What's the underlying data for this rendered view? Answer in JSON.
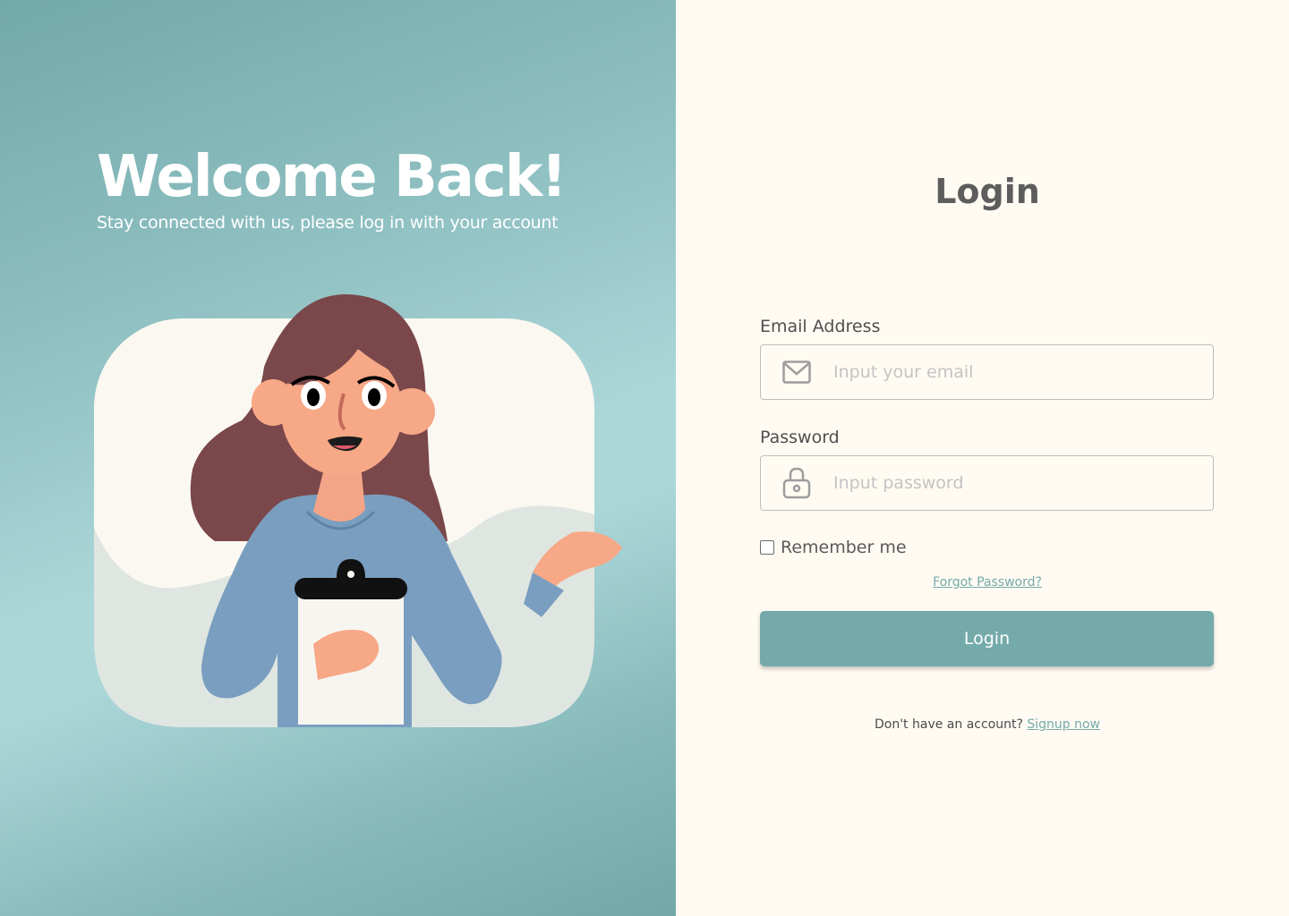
{
  "welcome": {
    "title": "Welcome Back!",
    "subtitle": "Stay connected with us, please log in with your account"
  },
  "login": {
    "title": "Login",
    "email": {
      "label": "Email Address",
      "placeholder": "Input your email",
      "icon": "envelope-icon"
    },
    "password": {
      "label": "Password",
      "placeholder": "Input password",
      "icon": "lock-icon"
    },
    "remember_label": "Remember me",
    "forgot_label": "Forgot Password?",
    "submit_label": "Login",
    "signup_prompt": "Don't have an account?",
    "signup_link": "Signup now"
  },
  "colors": {
    "accent": "#74aaaa",
    "background": "#fffbf3",
    "text": "#5d5d5d"
  }
}
